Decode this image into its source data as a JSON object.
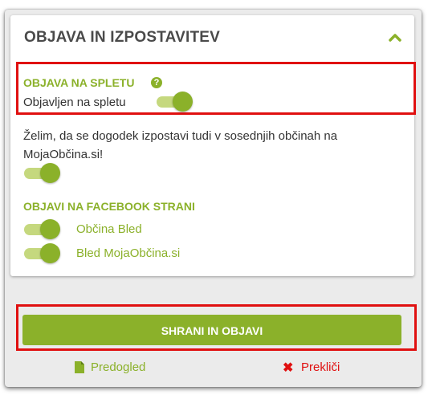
{
  "panel": {
    "title": "OBJAVA IN IZPOSTAVITEV",
    "collapse_icon": "chevron-up-icon"
  },
  "publish_section": {
    "title": "OBJAVA NA SPLETU",
    "help_icon": "question-circle-icon",
    "help_glyph": "?",
    "toggle_label": "Objavljen na spletu",
    "toggle_on": true
  },
  "neighbors": {
    "text_line1": "Želim, da se dogodek izpostavi tudi v sosednjih občinah na",
    "text_line2": "MojaObčina.si!",
    "toggle_on": true
  },
  "facebook_section": {
    "title": "OBJAVI NA FACEBOOK STRANI",
    "pages": [
      {
        "label": "Občina Bled",
        "on": true
      },
      {
        "label": "Bled MojaObčina.si",
        "on": true
      }
    ]
  },
  "actions": {
    "save_label": "SHRANI IN OBJAVI",
    "preview_label": "Predogled",
    "preview_icon": "document-icon",
    "cancel_label": "Prekliči",
    "cancel_icon": "close-icon",
    "cancel_glyph": "✖"
  },
  "colors": {
    "accent": "#8bb12a",
    "accent_light": "#c5d87e",
    "highlight": "#e01010",
    "title_text": "#4a4a4a"
  }
}
